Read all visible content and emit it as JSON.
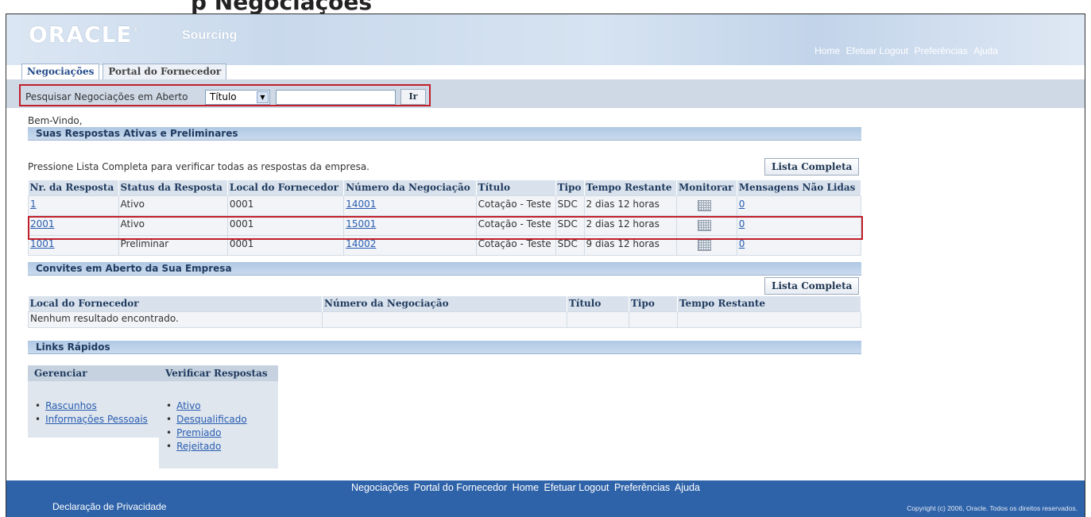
{
  "slide": {
    "title_partial": "p   Negociações"
  },
  "header": {
    "logo": "ORACLE",
    "logo_mark": "®",
    "product": "Sourcing",
    "global_links": [
      "Home",
      "Efetuar Logout",
      "Preferências",
      "Ajuda"
    ]
  },
  "tabs": [
    {
      "label": "Negociações",
      "active": true
    },
    {
      "label": "Portal do Fornecedor",
      "active": false
    }
  ],
  "search": {
    "label": "Pesquisar Negociações em Aberto",
    "field": "Título",
    "value": "",
    "go_label": "Ir"
  },
  "welcome": "Bem-Vindo,",
  "responses": {
    "title": "Suas Respostas Ativas e Preliminares",
    "hint": "Pressione Lista Completa para verificar todas as respostas da empresa.",
    "full_list_label": "Lista Completa",
    "columns": [
      "Nr. da Resposta",
      "Status da Resposta",
      "Local do Fornecedor",
      "Número da Negociação",
      "Título",
      "Tipo",
      "Tempo Restante",
      "Monitorar",
      "Mensagens Não Lidas"
    ],
    "rows": [
      {
        "nr": "1",
        "status": "Ativo",
        "local": "0001",
        "negociacao": "14001",
        "titulo": "Cotação - Teste",
        "tipo": "SDC",
        "tempo": "2 dias 12 horas",
        "monitor_icon": "calendar-grid-icon",
        "mensagens": "0"
      },
      {
        "nr": "2001",
        "status": "Ativo",
        "local": "0001",
        "negociacao": "15001",
        "titulo": "Cotação - Teste",
        "tipo": "SDC",
        "tempo": "2 dias 12 horas",
        "monitor_icon": "calendar-grid-icon",
        "mensagens": "0"
      },
      {
        "nr": "1001",
        "status": "Preliminar",
        "local": "0001",
        "negociacao": "14002",
        "titulo": "Cotação - Teste",
        "tipo": "SDC",
        "tempo": "9 dias 12 horas",
        "monitor_icon": "calendar-grid-icon",
        "mensagens": "0"
      }
    ]
  },
  "invites": {
    "title": "Convites em Aberto da Sua Empresa",
    "full_list_label": "Lista Completa",
    "columns": [
      "Local do Fornecedor",
      "Número da Negociação",
      "Título",
      "Tipo",
      "Tempo Restante"
    ],
    "empty_message": "Nenhum resultado encontrado."
  },
  "quick_links": {
    "title": "Links Rápidos",
    "manage": {
      "title": "Gerenciar",
      "items": [
        "Rascunhos",
        "Informações Pessoais"
      ]
    },
    "check": {
      "title": "Verificar Respostas",
      "items": [
        "Ativo",
        "Desqualificado",
        "Premiado",
        "Rejeitado"
      ]
    }
  },
  "footer": {
    "links": [
      "Negociações",
      "Portal do Fornecedor",
      "Home",
      "Efetuar Logout",
      "Preferências",
      "Ajuda"
    ],
    "privacy": "Declaração de Privacidade",
    "copyright": "Copyright (c) 2006, Oracle. Todos os direitos reservados."
  },
  "colors": {
    "header_bg": "#c9d9ec",
    "footer_bg": "#2f63a9",
    "highlight_border": "#c01f2a",
    "link": "#2a5db0"
  }
}
